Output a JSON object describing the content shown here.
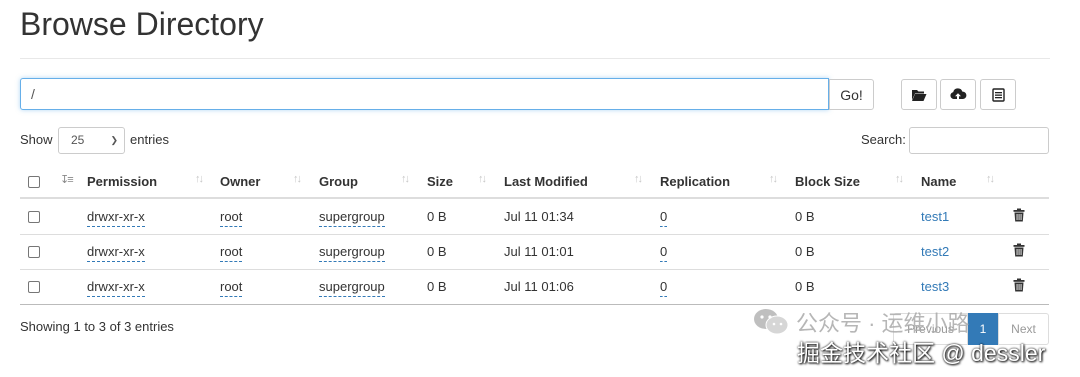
{
  "page_title": "Browse Directory",
  "path_input": {
    "value": "/"
  },
  "go_label": "Go!",
  "toolbar": {
    "icons": [
      "folder-open-icon",
      "cloud-upload-icon",
      "list-icon"
    ]
  },
  "show_label": "Show",
  "page_length": "25",
  "entries_label": "entries",
  "search_label": "Search:",
  "columns": [
    "Permission",
    "Owner",
    "Group",
    "Size",
    "Last Modified",
    "Replication",
    "Block Size",
    "Name"
  ],
  "rows": [
    {
      "permission": "drwxr-xr-x",
      "owner": "root",
      "group": "supergroup",
      "size": "0 B",
      "last_modified": "Jul 11 01:34",
      "replication": "0",
      "block_size": "0 B",
      "name": "test1"
    },
    {
      "permission": "drwxr-xr-x",
      "owner": "root",
      "group": "supergroup",
      "size": "0 B",
      "last_modified": "Jul 11 01:01",
      "replication": "0",
      "block_size": "0 B",
      "name": "test2"
    },
    {
      "permission": "drwxr-xr-x",
      "owner": "root",
      "group": "supergroup",
      "size": "0 B",
      "last_modified": "Jul 11 01:06",
      "replication": "0",
      "block_size": "0 B",
      "name": "test3"
    }
  ],
  "info_text": "Showing 1 to 3 of 3 entries",
  "pagination": {
    "previous": "Previous",
    "current": "1",
    "next": "Next"
  },
  "watermark": {
    "line1": "公众号 · 运维小路",
    "line2": "掘金技术社区 @ dessler"
  }
}
